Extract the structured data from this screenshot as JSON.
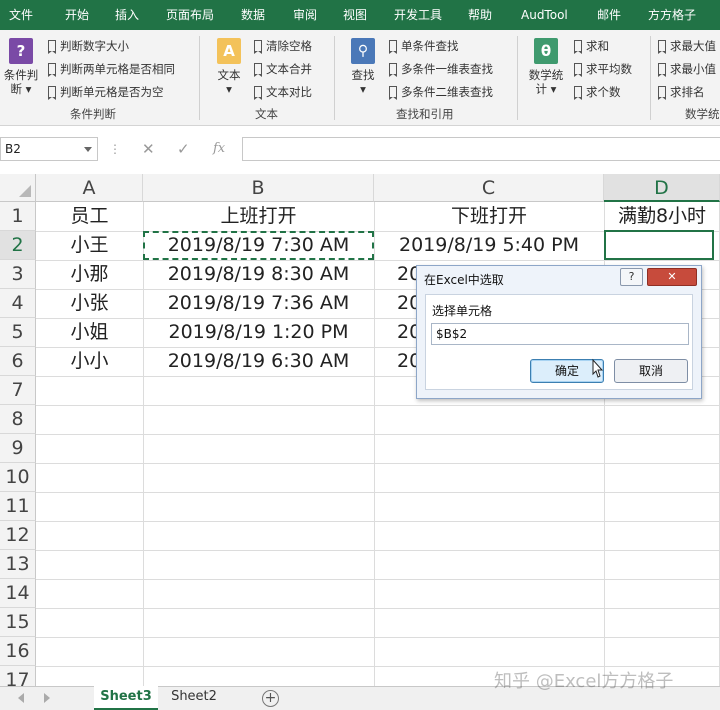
{
  "menu": [
    "文件",
    "开始",
    "插入",
    "页面布局",
    "数据",
    "审阅",
    "视图",
    "开发工具",
    "帮助",
    "AudTool",
    "邮件",
    "方方格子"
  ],
  "ribbon": {
    "condition": {
      "big_label_1": "条件判",
      "big_label_2": "断",
      "items": [
        "判断数字大小",
        "判断两单元格是否相同",
        "判断单元格是否为空"
      ],
      "group_label": "条件判断"
    },
    "text": {
      "big_label": "文本",
      "items": [
        "清除空格",
        "文本合并",
        "文本对比"
      ],
      "group_label": "文本"
    },
    "lookup": {
      "big_label": "查找",
      "items": [
        "单条件查找",
        "多条件一维表查找",
        "多条件二维表查找"
      ],
      "group_label": "查找和引用"
    },
    "math": {
      "big_label_1": "数学统",
      "big_label_2": "计",
      "items": [
        "求和",
        "求平均数",
        "求个数"
      ],
      "items2": [
        "求最大值",
        "求最小值",
        "求排名"
      ],
      "group_label": "数学统"
    }
  },
  "formula_bar": {
    "name_box": "B2",
    "cancel": "✕",
    "enter": "✓",
    "fx": "fx",
    "content": ""
  },
  "columns": [
    "A",
    "B",
    "C",
    "D"
  ],
  "rows": [
    "1",
    "2",
    "3",
    "4",
    "5",
    "6",
    "7",
    "8",
    "9",
    "10",
    "11",
    "12",
    "13",
    "14",
    "15",
    "16",
    "17"
  ],
  "table": {
    "headers": [
      "员工",
      "上班打开",
      "下班打开",
      "满勤8小时"
    ],
    "data": [
      [
        "小王",
        "2019/8/19 7:30 AM",
        "2019/8/19 5:40 PM",
        ""
      ],
      [
        "小那",
        "2019/8/19 8:30 AM",
        "20",
        ""
      ],
      [
        "小张",
        "2019/8/19 7:36 AM",
        "20",
        ""
      ],
      [
        "小姐",
        "2019/8/19 1:20 PM",
        "20",
        ""
      ],
      [
        "小小",
        "2019/8/19 6:30 AM",
        "20",
        ""
      ]
    ]
  },
  "dialog": {
    "title": "在Excel中选取",
    "help": "?",
    "close": "✕",
    "label": "选择单元格",
    "value": "$B$2",
    "ok": "确定",
    "cancel": "取消"
  },
  "sheets": [
    "Sheet3",
    "Sheet2"
  ],
  "add_sheet": "+",
  "watermark": "知乎 @Excel方方格子",
  "colors": {
    "accent": "#217346"
  }
}
